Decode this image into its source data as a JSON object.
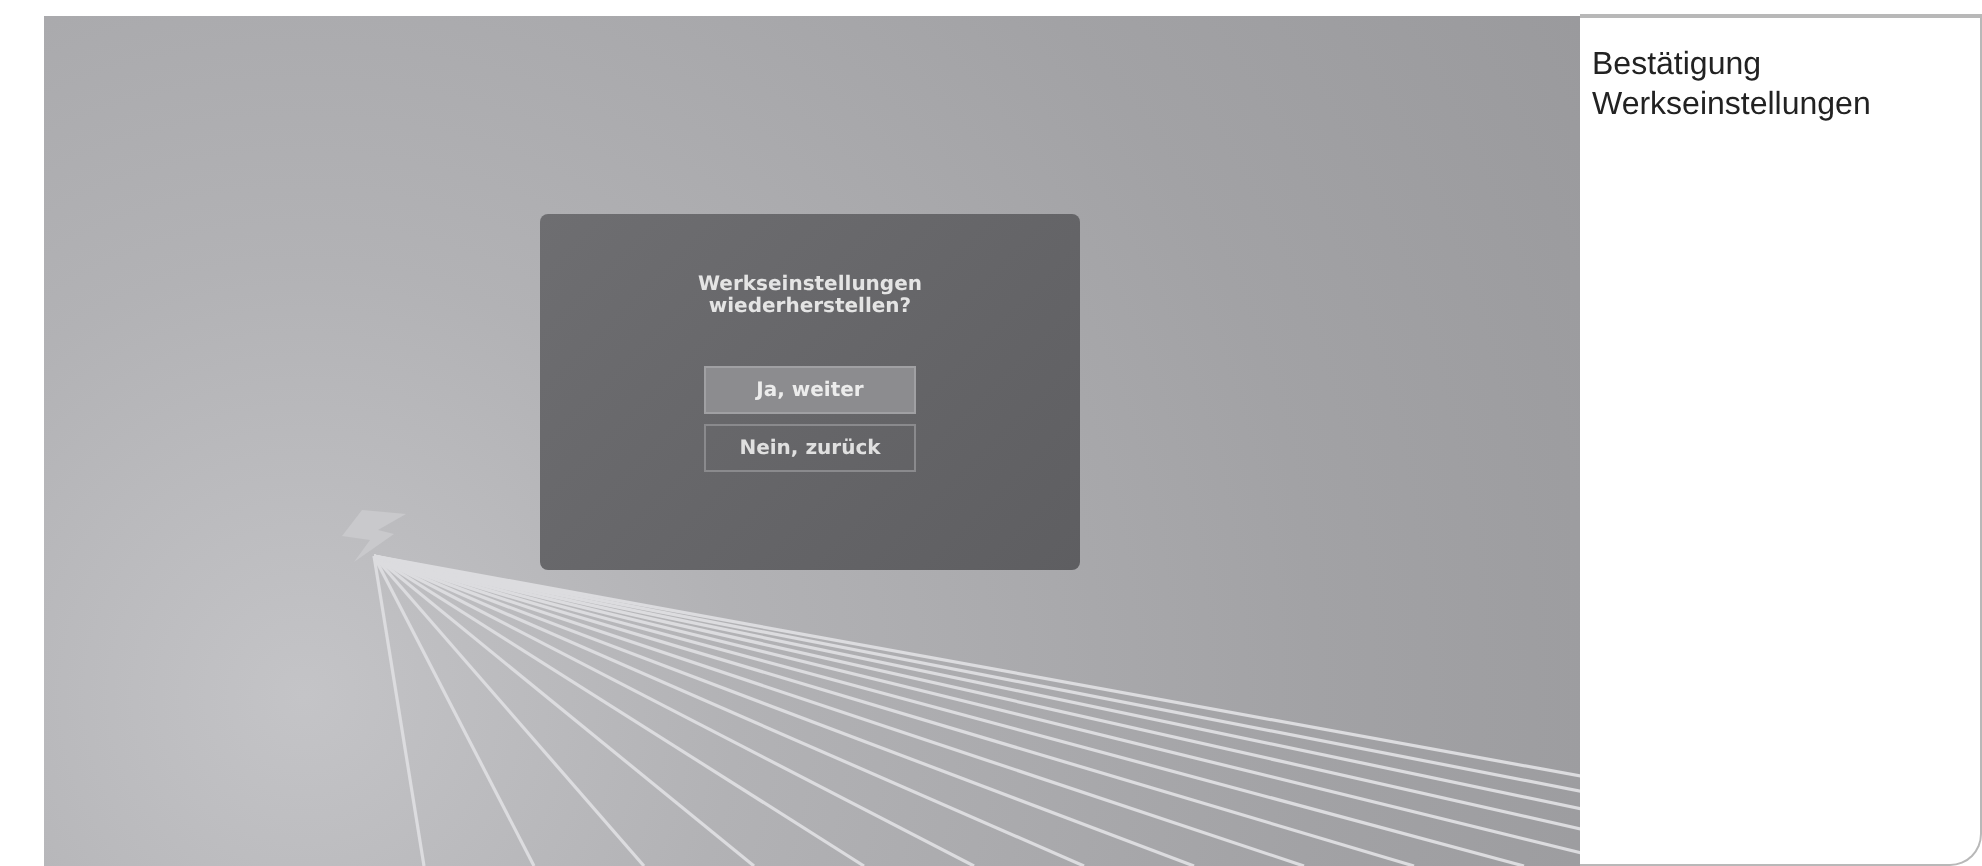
{
  "screen": {
    "dialog": {
      "title": "Werkseinstellungen\nwiederherstellen?",
      "buttons": [
        {
          "label": "Ja, weiter",
          "selected": true
        },
        {
          "label": "Nein, zurück",
          "selected": false
        }
      ]
    }
  },
  "caption": {
    "text": "Bestätigung Werkseinstellungen"
  }
}
